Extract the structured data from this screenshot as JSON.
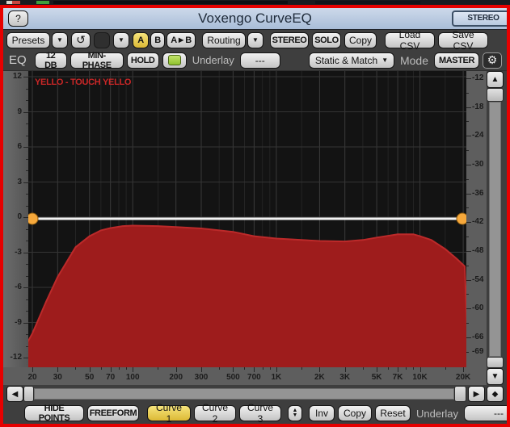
{
  "window": {
    "help": "?",
    "title": "Voxengo CurveEQ",
    "stereo": "STEREO"
  },
  "toolbar": {
    "presets": "Presets",
    "arrow": "▼",
    "undo": "↺",
    "a": "A",
    "b": "B",
    "ab": "A►B",
    "routing": "Routing",
    "stereo": "STEREO",
    "solo": "SOLO",
    "copy": "Copy",
    "load_csv": "Load CSV",
    "save_csv": "Save CSV"
  },
  "eq_bar": {
    "tab": "EQ",
    "db12": "12 DB",
    "minphase": "MIN-PHASE",
    "hold": "HOLD",
    "underlay_label": "Underlay",
    "underlay_value": "---",
    "static_match": "Static & Match",
    "arrow": "▼",
    "mode_label": "Mode",
    "mode_value": "MASTER",
    "gear": "⚙"
  },
  "bottom_bar": {
    "hide_points": "HIDE POINTS",
    "freeform": "FREEFORM",
    "curve1": "Curve 1",
    "curve2": "Curve 2",
    "curve3": "Curve 3",
    "updown": "▲▼",
    "inv": "Inv",
    "copy": "Copy",
    "reset": "Reset",
    "underlay_label": "Underlay",
    "underlay_value": "---"
  },
  "scroll": {
    "left": "◀",
    "right": "▶",
    "up": "▲",
    "down": "▼",
    "diamond": "◆"
  },
  "colors": {
    "frame_red": "#e60000",
    "titlebar_blue": "#b9c9e0",
    "accent_yellow": "#e8cf5f",
    "led_green": "#9ac93c",
    "spectrum_red": "#9e1c1c",
    "eq_line_white": "#f2f2f2",
    "handle_orange": "#f6a83b",
    "legend_red": "#cb2727"
  },
  "chart_data": {
    "type": "area",
    "title": "YELLO - TOUCH YELLO",
    "x_axis": {
      "scale": "log",
      "unit": "Hz",
      "min": 20,
      "max": 20000,
      "major_ticks": [
        {
          "f": 20,
          "label": "20"
        },
        {
          "f": 30,
          "label": "30"
        },
        {
          "f": 50,
          "label": "50"
        },
        {
          "f": 70,
          "label": "70"
        },
        {
          "f": 100,
          "label": "100"
        },
        {
          "f": 200,
          "label": "200"
        },
        {
          "f": 300,
          "label": "300"
        },
        {
          "f": 500,
          "label": "500"
        },
        {
          "f": 700,
          "label": "700"
        },
        {
          "f": 1000,
          "label": "1K"
        },
        {
          "f": 2000,
          "label": "2K"
        },
        {
          "f": 3000,
          "label": "3K"
        },
        {
          "f": 5000,
          "label": "5K"
        },
        {
          "f": 7000,
          "label": "7K"
        },
        {
          "f": 10000,
          "label": "10K"
        },
        {
          "f": 20000,
          "label": "20K"
        }
      ],
      "minor_ticks": [
        40,
        60,
        80,
        90,
        150,
        400,
        600,
        800,
        900,
        1500,
        4000,
        6000,
        8000,
        9000,
        15000
      ]
    },
    "y_left": {
      "unit": "dB",
      "min": -12.8,
      "max": 12.5,
      "ticks": [
        12,
        9,
        6,
        3,
        0,
        -3,
        -6,
        -9,
        -12
      ]
    },
    "y_right": {
      "unit": "dB",
      "min": -70,
      "max": -10.8,
      "ticks": [
        -12,
        -18,
        -24,
        -30,
        -36,
        -42,
        -48,
        -54,
        -60,
        -66,
        -69
      ]
    },
    "spectrum": {
      "name": "input-spectrum",
      "axis": "right",
      "color": "#9e1c1c",
      "edge_color": "#bc2a2a",
      "points": [
        [
          18.5,
          -67.0
        ],
        [
          20,
          -65.2
        ],
        [
          25,
          -58.5
        ],
        [
          30,
          -53.4
        ],
        [
          40,
          -47.2
        ],
        [
          50,
          -44.9
        ],
        [
          60,
          -43.7
        ],
        [
          70,
          -43.2
        ],
        [
          85,
          -42.8
        ],
        [
          100,
          -42.7
        ],
        [
          150,
          -42.8
        ],
        [
          200,
          -43.0
        ],
        [
          300,
          -43.3
        ],
        [
          400,
          -43.7
        ],
        [
          500,
          -44.0
        ],
        [
          700,
          -44.9
        ],
        [
          1000,
          -45.4
        ],
        [
          1500,
          -45.7
        ],
        [
          2000,
          -45.9
        ],
        [
          3000,
          -46.0
        ],
        [
          4000,
          -45.7
        ],
        [
          5000,
          -45.2
        ],
        [
          7000,
          -44.5
        ],
        [
          9000,
          -44.5
        ],
        [
          10000,
          -44.9
        ],
        [
          12000,
          -45.7
        ],
        [
          15000,
          -47.6
        ],
        [
          18000,
          -49.6
        ],
        [
          20500,
          -51.2
        ]
      ]
    },
    "eq_curve": {
      "name": "Curve 1",
      "axis": "left",
      "gain_db": 0,
      "color": "#f2f2f2",
      "points": [
        [
          20,
          0
        ],
        [
          20000,
          0
        ]
      ],
      "handles": {
        "color": "#f6a83b",
        "points": [
          [
            20,
            0
          ],
          [
            20000,
            0
          ]
        ]
      }
    }
  }
}
